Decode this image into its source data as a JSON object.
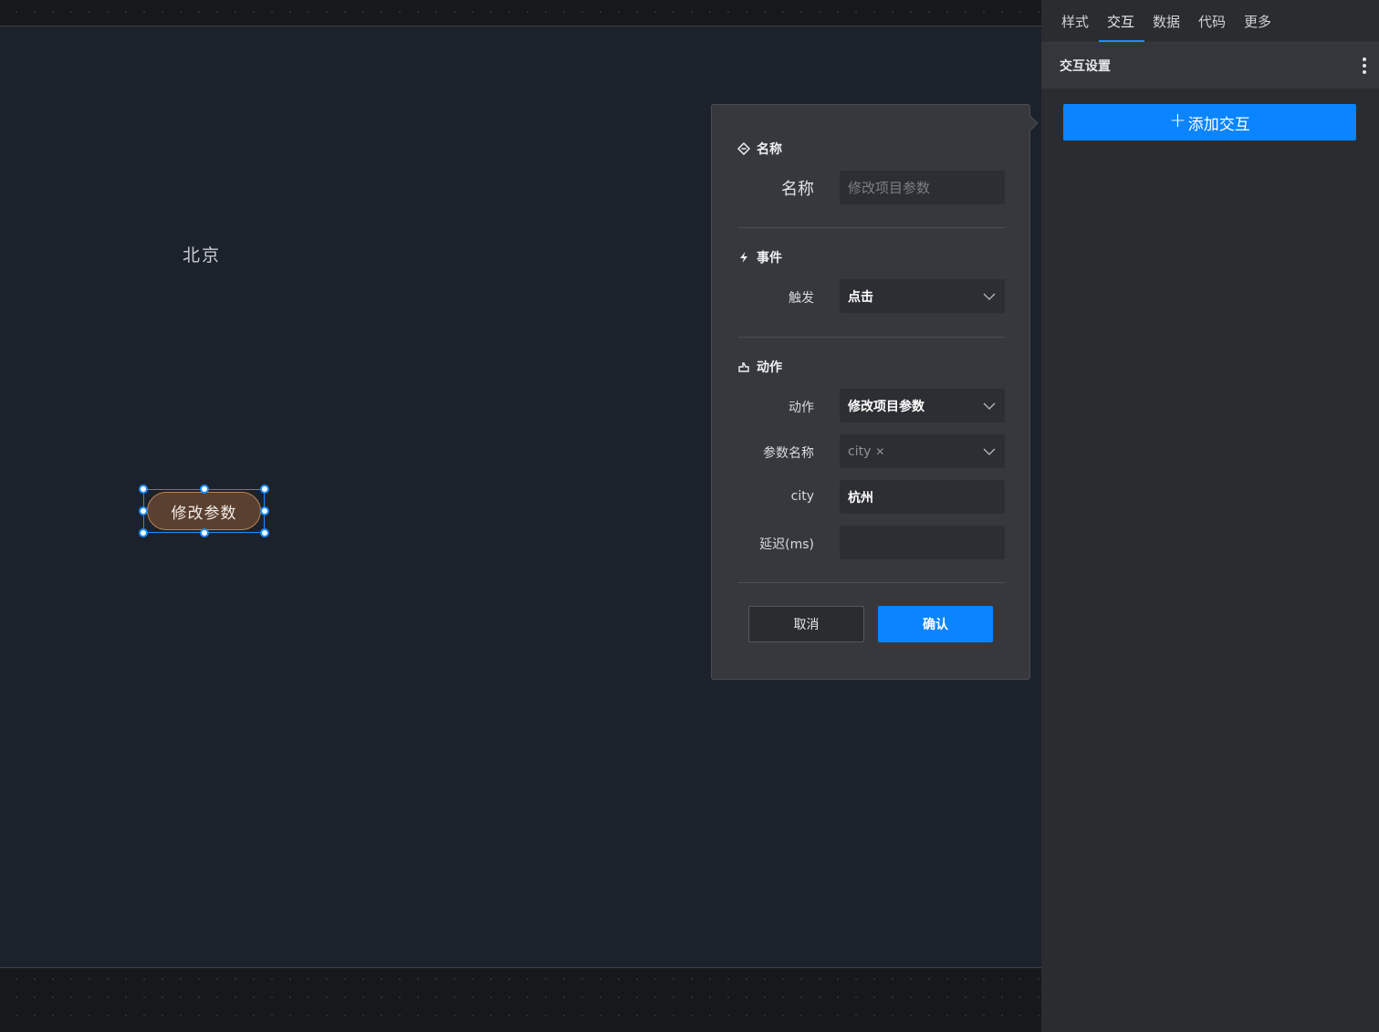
{
  "canvas": {
    "text_component": "北京",
    "button_component": "修改参数"
  },
  "popover": {
    "name_section": {
      "title": "名称",
      "label": "名称",
      "placeholder": "修改项目参数",
      "value": ""
    },
    "event_section": {
      "title": "事件",
      "trigger_label": "触发",
      "trigger_value": "点击"
    },
    "action_section": {
      "title": "动作",
      "action_label": "动作",
      "action_value": "修改项目参数",
      "param_label": "参数名称",
      "param_tag": "city",
      "city_label": "city",
      "city_value": "杭州",
      "delay_label": "延迟(ms)",
      "delay_value": ""
    },
    "cancel_label": "取消",
    "confirm_label": "确认"
  },
  "right_panel": {
    "tabs": [
      "样式",
      "交互",
      "数据",
      "代码",
      "更多"
    ],
    "active_tab": "交互",
    "section_title": "交互设置",
    "add_button_label": "添加交互",
    "add_button_icon": "plus-icon"
  },
  "colors": {
    "accent": "#0a84ff",
    "button_fill": "#5a4030",
    "canvas_bg": "#1c222b"
  }
}
